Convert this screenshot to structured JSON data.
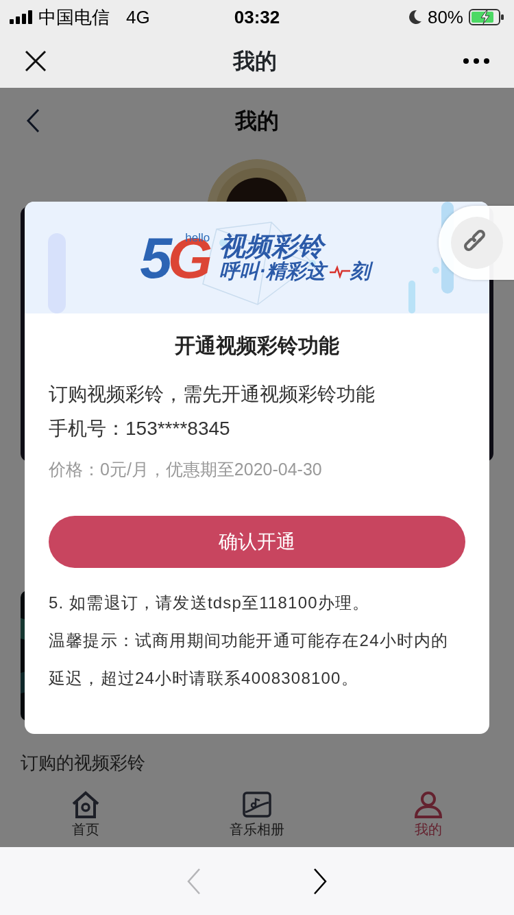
{
  "status_bar": {
    "carrier": "中国电信",
    "network": "4G",
    "time": "03:32",
    "battery": "80%"
  },
  "header": {
    "title": "我的"
  },
  "page": {
    "title": "我的",
    "section_title": "订购的视频彩铃"
  },
  "tab_bar": [
    {
      "label": "首页",
      "kind": "home",
      "selected": false
    },
    {
      "label": "音乐相册",
      "kind": "album",
      "selected": false
    },
    {
      "label": "我的",
      "kind": "person",
      "selected": true
    }
  ],
  "dialog": {
    "banner": {
      "logo": "5G",
      "logo_sub": "hello",
      "title": "视频彩铃",
      "slogan": "呼叫·精彩这",
      "slogan_end": "刻"
    },
    "title": "开通视频彩铃功能",
    "lines": [
      "订购视频彩铃，需先开通视频彩铃功能",
      "手机号：153****8345"
    ],
    "price": "价格：0元/月，优惠期至2020-04-30",
    "confirm_button": "确认开通",
    "notes": [
      "5. 如需退订，请发送tdsp至118100办理。",
      "温馨提示：试商用期间功能开通可能存在24小时内的延迟，超过24小时请联系4008308100。"
    ]
  },
  "browser_bar": {
    "back_disabled": true,
    "forward_disabled": false
  }
}
